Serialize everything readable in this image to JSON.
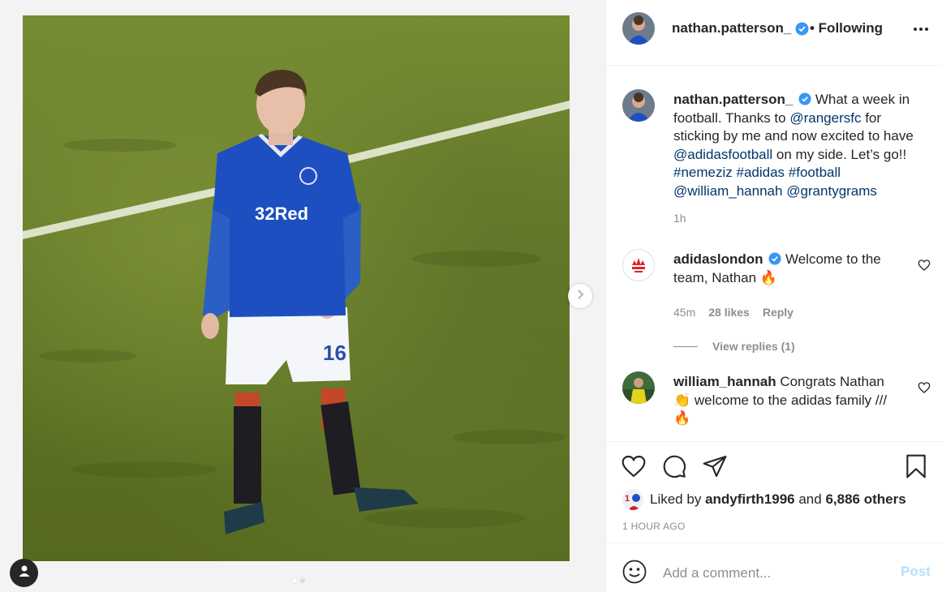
{
  "post": {
    "username": "nathan.patterson_",
    "follow_status": "• Following",
    "more_icon": "more-horizontal-icon",
    "caption": {
      "part1": "What a week in football. Thanks to",
      "mention1": "@rangersfc",
      "part2": "for sticking by me and now excited to have",
      "mention2": "@adidasfootball",
      "part3": "on my side. Let’s go!!",
      "hashtag1": "#nemeziz",
      "hashtag2": "#adidas",
      "hashtag3": "#football",
      "mention3": "@william_hannah",
      "mention4": "@grantygrams"
    },
    "caption_time": "1h"
  },
  "media": {
    "shirt_sponsor": "32Red",
    "shirt_number": "16",
    "carousel_dots": 2,
    "active_dot": 0
  },
  "comments": [
    {
      "username": "adidaslondon",
      "verified": true,
      "text": "Welcome to the team, Nathan 🔥",
      "time": "45m",
      "likes": "28 likes",
      "reply": "Reply",
      "view_replies": "View replies (1)"
    },
    {
      "username": "william_hannah",
      "verified": false,
      "text": "Congrats Nathan 👏 welcome to the adidas family /// 🔥"
    }
  ],
  "engagement": {
    "liked_by_prefix": "Liked by",
    "liked_by_user": "andyfirth1996",
    "and": "and",
    "others": "6,886 others",
    "timestamp": "1 HOUR AGO"
  },
  "comment_box": {
    "placeholder": "Add a comment...",
    "post_label": "Post"
  },
  "colors": {
    "link": "#00376b",
    "verified": "#3897f0",
    "muted": "#8e8e8e",
    "post_disabled": "#b2dffc"
  }
}
